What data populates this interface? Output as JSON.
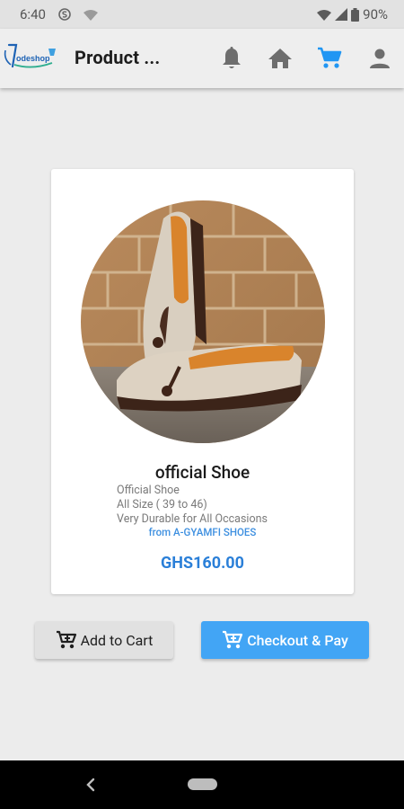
{
  "status_bar": {
    "time": "6:40",
    "battery": "90%",
    "icons": [
      "s-circle-icon",
      "wifi-off-icon",
      "wifi-icon",
      "signal-icon",
      "battery-icon"
    ]
  },
  "app_bar": {
    "title": "Product ...",
    "logo_text": "odeshop",
    "actions": [
      "bell-icon",
      "home-icon",
      "cart-icon",
      "person-icon"
    ],
    "active_color": "#2196f3"
  },
  "product": {
    "name": "official Shoe",
    "description_lines": [
      "Official Shoe",
      "All Size ( 39 to 46)",
      "Very Durable for All Occasions"
    ],
    "seller": "from A-GYAMFI SHOES",
    "price": "GHS160.00"
  },
  "buttons": {
    "add_to_cart": "Add to Cart",
    "checkout": "Checkout & Pay"
  },
  "colors": {
    "accent": "#42a5f5",
    "price": "#2a7fd8",
    "background": "#ececec"
  }
}
